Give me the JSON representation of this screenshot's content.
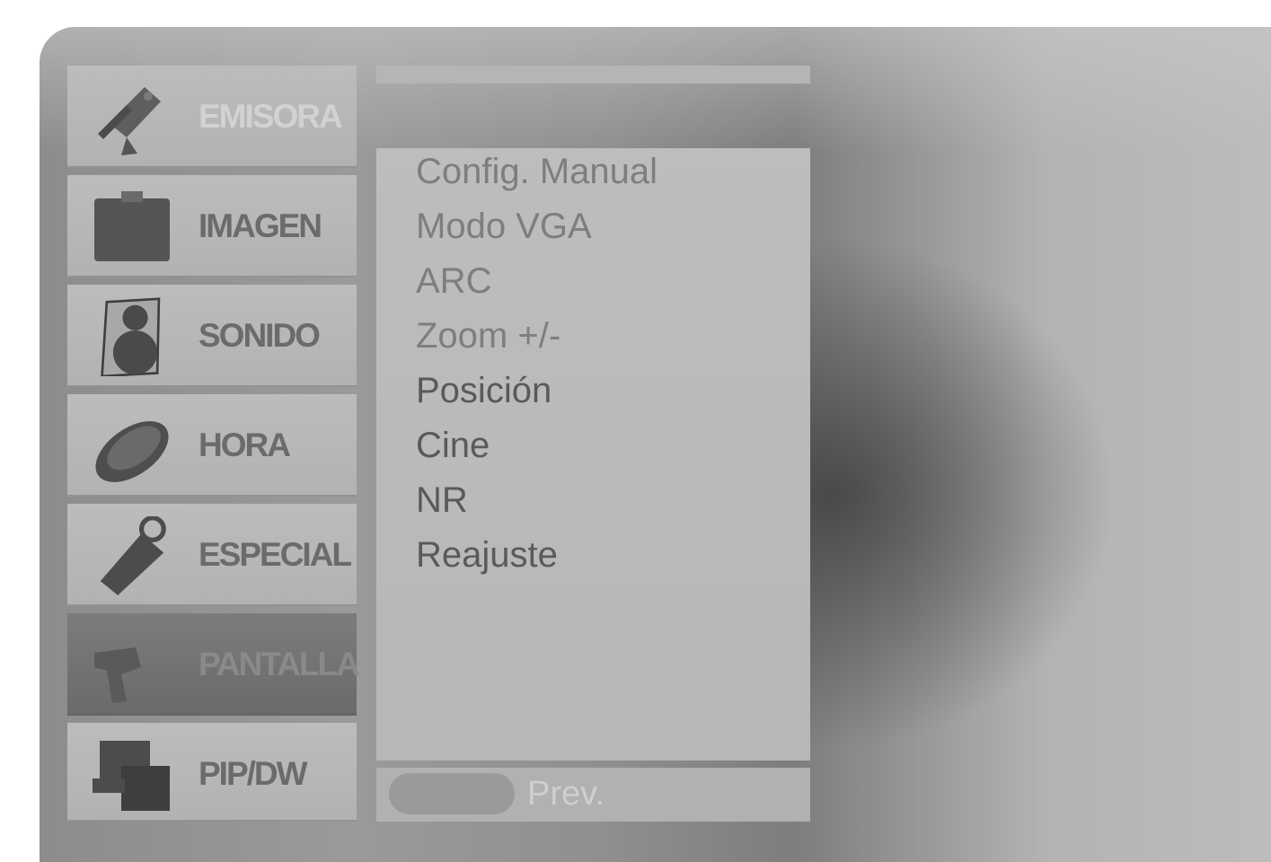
{
  "menu": {
    "tabs": [
      {
        "label": "EMISORA",
        "icon": "satellite-dish-icon"
      },
      {
        "label": "IMAGEN",
        "icon": "picture-icon"
      },
      {
        "label": "SONIDO",
        "icon": "speaker-icon"
      },
      {
        "label": "HORA",
        "icon": "clock-icon"
      },
      {
        "label": "ESPECIAL",
        "icon": "key-tag-icon"
      },
      {
        "label": "PANTALLA",
        "icon": "screen-icon"
      },
      {
        "label": "PIP/DW",
        "icon": "pip-icon"
      }
    ],
    "active_tab": "PANTALLA"
  },
  "submenu": {
    "items": [
      "Config. Manual",
      "Modo VGA",
      "ARC",
      "Zoom +/-",
      "Posición",
      "Cine",
      "NR",
      "Reajuste"
    ]
  },
  "footer": {
    "prev_label": "Prev."
  },
  "colors": {
    "panel": "#b9b9b9",
    "active_tab": "#727272",
    "text": "#5a5a5a"
  }
}
